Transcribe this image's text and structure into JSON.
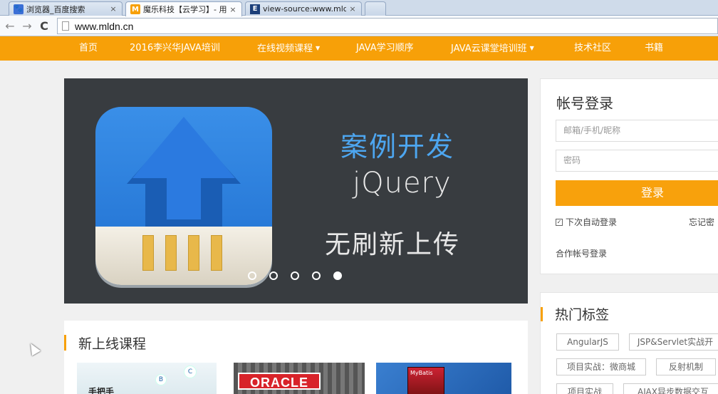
{
  "browser": {
    "tabs": [
      {
        "title": "浏览器_百度搜索",
        "icon": "baidu-paw-icon"
      },
      {
        "title": "魔乐科技【云学习】- 用",
        "icon": "mldn-icon"
      },
      {
        "title": "view-source:www.mldn",
        "icon": "e-icon"
      }
    ],
    "close_glyph": "×",
    "back_glyph": "←",
    "forward_glyph": "→",
    "reload_glyph": "C",
    "url": "www.mldn.cn"
  },
  "nav": {
    "items": [
      "首页",
      "2016李兴华JAVA培训",
      "在线视频课程",
      "JAVA学习顺序",
      "JAVA云课堂培训班",
      "技术社区",
      "书籍"
    ],
    "caret": "▼"
  },
  "banner": {
    "headline": "案例开发",
    "sub1": "jQuery",
    "sub2": "无刷新上传",
    "slide_count": 5,
    "active_slide": 5
  },
  "login": {
    "title": "帐号登录",
    "username_placeholder": "邮箱/手机/昵称",
    "password_placeholder": "密码",
    "submit": "登录",
    "remember": "下次自动登录",
    "check_glyph": "✓",
    "forgot": "忘记密",
    "partner": "合作帐号登录"
  },
  "tags": {
    "title": "热门标签",
    "items": [
      "AngularJS",
      "JSP&Servlet实战开",
      "项目实战：微商城",
      "反射机制",
      "项目实战",
      "AJAX异步数据交互"
    ]
  },
  "courses": {
    "title": "新上线课程",
    "thumb1_text": "手把手",
    "thumb1_bubble_b": "B",
    "thumb1_bubble_c": "C",
    "thumb2_text": "ORACLE",
    "thumb3_text": "MyBatis"
  },
  "colors": {
    "accent": "#f7a008",
    "banner_bg": "#383c40",
    "headline_blue": "#4da6f0"
  }
}
